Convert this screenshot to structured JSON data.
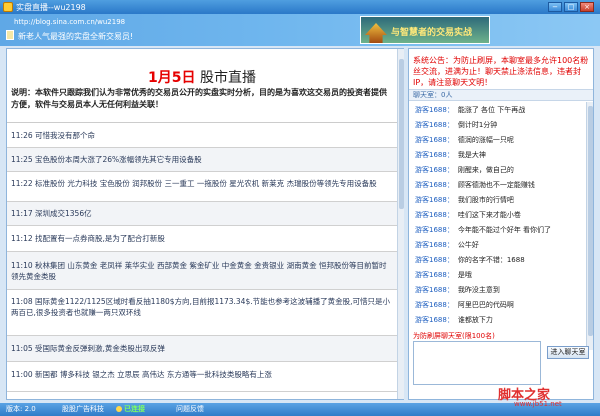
{
  "window": {
    "title": "实盘直播--wu2198",
    "minimize": "−",
    "maximize": "□",
    "close": "×"
  },
  "banner": {
    "url": "http://blog.sina.com.cn/wu2198",
    "slogan": "新老人气最强的实盘全新交易员!",
    "promo_text": "与智慧者的交易实战"
  },
  "headline": {
    "date": "1月5日",
    "name": "股市直播",
    "intro": "说明：本软件只跟踪我们认为非常优秀的交易员公开的实盘实时分析，目的是为喜欢这交易员的投资者提供方便，软件与交易员本人无任何利益关联！"
  },
  "feed": [
    "11:26 可惜我没有那个命",
    "11:25 宝色股份本周大涨了26%涨幅领先其它专用设备股",
    "11:22 标准股份 光力科技 宝色股份 润邦股份 三一重工 一拖股份 星光农机 新莱克 杰瑞股份等领先专用设备股",
    "11:17 深圳成交1356亿",
    "11:12 找配置有一点券商股,是为了配合打新股",
    "11:10 秋林集团 山东黄金 老凤祥 莱华实业 西部黄金 紫金矿业 中金黄金 金贵银业 湖南黄金 恒邦股份等目前暂时领先黄金类股",
    "11:08 国际黄金1122/1125区域时看反抽1180$方向,目前报1173.34$.节能也参考这波辅播了黄金股,可惜只是小两百已,很多投资者也就赚一两只双环线",
    "11:05 受国际黄金反弹刺激,黄金类股出现反弹",
    "11:00 新国都 博多科技 银之杰 立思辰 高伟达 东方通等一批科技类股略有上涨"
  ],
  "notice": {
    "label": "系统公告：",
    "text": "为防止刷屏，本聊室最多允许100名粉丝交流，进满为止！聊天禁止涤法信息，违者封IP，请注意聊天文明！"
  },
  "chat": {
    "header": "聊天室：0人",
    "messages": [
      {
        "user": "游客1688：",
        "text": "能涨了 各位 下午再战"
      },
      {
        "user": "游客1688：",
        "text": "倒计时1分钟"
      },
      {
        "user": "游客1688：",
        "text": "德润的涨幅一只呢"
      },
      {
        "user": "游客1688：",
        "text": "我是大神"
      },
      {
        "user": "游客1688：",
        "text": "刚醒来，做自己的"
      },
      {
        "user": "游客1688：",
        "text": "顾客德渤也不一定能赚钱"
      },
      {
        "user": "游客1688：",
        "text": "我们股市的行情吧"
      },
      {
        "user": "游客1688：",
        "text": "哇们这下来才能小卷"
      },
      {
        "user": "游客1688：",
        "text": "今年能不能过个好年 看你们了"
      },
      {
        "user": "游客1688：",
        "text": "公牛好"
      },
      {
        "user": "游客1688：",
        "text": "你的名字不错：1688"
      },
      {
        "user": "游客1688：",
        "text": "是哦"
      },
      {
        "user": "游客1688：",
        "text": "我昨没主意到"
      },
      {
        "user": "游客1688：",
        "text": "阿里巴巴的代码啊"
      },
      {
        "user": "游客1688：",
        "text": "谁都放下力"
      }
    ],
    "input_label": "为防刷屏聊天室(限100名)",
    "input_value": "",
    "enter_button": "进入聊天室"
  },
  "statusbar": {
    "version": "版本: 2.0",
    "sponsor": "股股广告科技",
    "online": "已连接",
    "feedback": "问题反馈"
  },
  "watermark": {
    "text": "脚本之家",
    "url": "www.jb51.net"
  },
  "colors": {
    "accent": "#2a78c8",
    "alert": "#e00000",
    "date": "#e60000",
    "user": "#2060c0"
  }
}
